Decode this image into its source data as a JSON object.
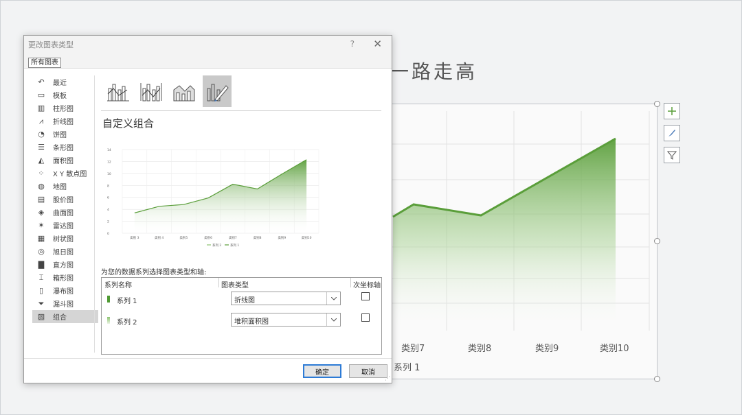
{
  "slide": {
    "title_fragment": "一路走高",
    "x_labels": [
      "类别7",
      "类别8",
      "类别9",
      "类别10"
    ],
    "legend": "系列 1",
    "side_tools": [
      "plus-icon",
      "brush-icon",
      "filter-icon"
    ],
    "line_color": "#5a9e3a"
  },
  "dialog": {
    "title": "更改图表类型",
    "help": "?",
    "close": "✕",
    "tab": "所有图表",
    "nav": [
      {
        "label": "最近",
        "icon": "recent-icon"
      },
      {
        "label": "模板",
        "icon": "template-icon"
      },
      {
        "label": "柱形图",
        "icon": "column-chart-icon"
      },
      {
        "label": "折线图",
        "icon": "line-chart-icon"
      },
      {
        "label": "饼图",
        "icon": "pie-chart-icon"
      },
      {
        "label": "条形图",
        "icon": "bar-chart-icon"
      },
      {
        "label": "面积图",
        "icon": "area-chart-icon"
      },
      {
        "label": "X Y 散点图",
        "icon": "scatter-chart-icon"
      },
      {
        "label": "地图",
        "icon": "map-chart-icon"
      },
      {
        "label": "股价图",
        "icon": "stock-chart-icon"
      },
      {
        "label": "曲面图",
        "icon": "surface-chart-icon"
      },
      {
        "label": "雷达图",
        "icon": "radar-chart-icon"
      },
      {
        "label": "树状图",
        "icon": "treemap-chart-icon"
      },
      {
        "label": "旭日图",
        "icon": "sunburst-chart-icon"
      },
      {
        "label": "直方图",
        "icon": "histogram-chart-icon"
      },
      {
        "label": "箱形图",
        "icon": "box-chart-icon"
      },
      {
        "label": "瀑布图",
        "icon": "waterfall-chart-icon"
      },
      {
        "label": "漏斗图",
        "icon": "funnel-chart-icon"
      },
      {
        "label": "组合",
        "icon": "combo-chart-icon",
        "active": true
      }
    ],
    "subtype_title": "自定义组合",
    "series_caption": "为您的数据系列选择图表类型和轴:",
    "table_headers": {
      "name": "系列名称",
      "type": "图表类型",
      "secondary": "次坐标轴"
    },
    "series": [
      {
        "name": "系列 1",
        "chart_type": "折线图",
        "swatch": "#4f9a33",
        "secondary": false
      },
      {
        "name": "系列 2",
        "chart_type": "堆积面积图",
        "swatch": "#8cc370",
        "secondary": false
      }
    ],
    "ok": "确定",
    "cancel": "取消"
  },
  "chart_data": {
    "type": "area",
    "categories": [
      "类别 3",
      "类别 4",
      "类别5",
      "类别6",
      "类别7",
      "类别8",
      "类别9",
      "类别10"
    ],
    "series": [
      {
        "name": "系列 2",
        "values": [
          3.4,
          4.5,
          4.8,
          5.9,
          8.2,
          7.4,
          9.9,
          12.3
        ]
      },
      {
        "name": "系列 1",
        "values": [
          3.4,
          4.5,
          4.8,
          5.9,
          8.2,
          7.4,
          9.9,
          12.3
        ]
      }
    ],
    "ylim": [
      0,
      14
    ],
    "yticks": [
      0,
      2,
      4,
      6,
      8,
      10,
      12,
      14
    ],
    "legend_position": "bottom",
    "grid": true
  }
}
